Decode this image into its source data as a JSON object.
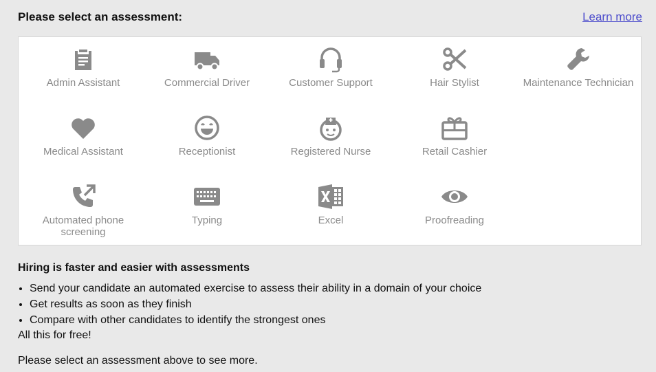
{
  "header": {
    "title": "Please select an assessment:",
    "learn_more": "Learn more"
  },
  "colors": {
    "background": "#e9e9e9",
    "panel": "#ffffff",
    "icon": "#8a8a8a",
    "link": "#4d4dcc"
  },
  "assessments": [
    {
      "label": "Admin Assistant",
      "icon": "clipboard-icon"
    },
    {
      "label": "Commercial Driver",
      "icon": "truck-icon"
    },
    {
      "label": "Customer Support",
      "icon": "headset-icon"
    },
    {
      "label": "Hair Stylist",
      "icon": "scissors-icon"
    },
    {
      "label": "Maintenance Technician",
      "icon": "wrench-icon"
    },
    {
      "label": "Medical Assistant",
      "icon": "heart-icon"
    },
    {
      "label": "Receptionist",
      "icon": "smiley-icon"
    },
    {
      "label": "Registered Nurse",
      "icon": "nurse-icon"
    },
    {
      "label": "Retail Cashier",
      "icon": "gift-card-icon"
    },
    {
      "label": "Automated phone screening",
      "icon": "phone-callout-icon"
    },
    {
      "label": "Typing",
      "icon": "keyboard-icon"
    },
    {
      "label": "Excel",
      "icon": "excel-icon"
    },
    {
      "label": "Proofreading",
      "icon": "eye-icon"
    }
  ],
  "info": {
    "heading": "Hiring is faster and easier with assessments",
    "bullets": [
      "Send your candidate an automated exercise to assess their ability in a domain of your choice",
      "Get results as soon as they finish",
      "Compare with other candidates to identify the strongest ones"
    ],
    "free_text": "All this for free!",
    "select_note": "Please select an assessment above to see more."
  }
}
